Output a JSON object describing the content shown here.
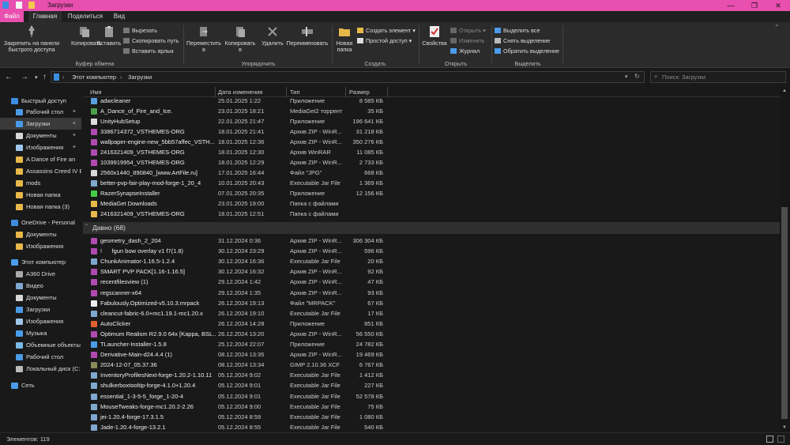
{
  "window": {
    "title": "Загрузки",
    "min": "—",
    "max": "❐",
    "close": "✕"
  },
  "tabs": [
    "Файл",
    "Главная",
    "Поделиться",
    "Вид"
  ],
  "ribbon": {
    "pin": "Закрепить на панели быстрого доступа",
    "copy": "Копировать",
    "paste": "Вставить",
    "cut": "Вырезать",
    "copy_path": "Скопировать путь",
    "paste_shortcut": "Вставить ярлык",
    "group_clipboard": "Буфер обмена",
    "move_to": "Переместить в",
    "copy_to": "Копировать в",
    "delete": "Удалить",
    "rename": "Переименовать",
    "group_organize": "Упорядочить",
    "new_folder": "Новая папка",
    "new_item": "Создать элемент",
    "easy_access": "Простой доступ",
    "group_create": "Создать",
    "properties": "Свойства",
    "open": "Открыть",
    "edit": "Изменить",
    "history": "Журнал",
    "group_open": "Открыть",
    "select_all": "Выделить все",
    "select_none": "Снять выделение",
    "invert": "Обратить выделение",
    "group_select": "Выделить"
  },
  "address": {
    "pc": "Этот компьютер",
    "folder": "Загрузки",
    "search_placeholder": "Поиск: Загрузки",
    "sep": "›"
  },
  "sidebar": [
    {
      "label": "Быстрый доступ",
      "icon": "star-icon",
      "color": "#3c8de0",
      "indent": 0
    },
    {
      "label": "Рабочий стол",
      "icon": "folder-icon",
      "color": "#4a9be8",
      "indent": 1
    },
    {
      "label": "Загрузки",
      "icon": "download-icon",
      "color": "#4a9be8",
      "indent": 1
    },
    {
      "label": "Документы",
      "icon": "document-icon",
      "color": "#d8d8d8",
      "indent": 1
    },
    {
      "label": "Изображения",
      "icon": "image-icon",
      "color": "#9fc7ec",
      "indent": 1
    },
    {
      "label": "A Dance of Fire an",
      "icon": "folder-icon",
      "color": "#e8b84a",
      "indent": 1
    },
    {
      "label": "Assassins Creed IV Bl",
      "icon": "folder-icon",
      "color": "#e8b84a",
      "indent": 1
    },
    {
      "label": "mods",
      "icon": "folder-icon",
      "color": "#e8b84a",
      "indent": 1
    },
    {
      "label": "Новая папка",
      "icon": "folder-icon",
      "color": "#e8b84a",
      "indent": 1
    },
    {
      "label": "Новая папка (3)",
      "icon": "folder-icon",
      "color": "#e8b84a",
      "indent": 1
    },
    {
      "label": "OneDrive - Personal",
      "icon": "cloud-icon",
      "color": "#3c8de0",
      "indent": 0
    },
    {
      "label": "Документы",
      "icon": "folder-icon",
      "color": "#e8b84a",
      "indent": 1
    },
    {
      "label": "Изображения",
      "icon": "folder-icon",
      "color": "#e8b84a",
      "indent": 1
    },
    {
      "label": "Этот компьютер",
      "icon": "computer-icon",
      "color": "#4a9be8",
      "indent": 0
    },
    {
      "label": "A360 Drive",
      "icon": "drive-icon",
      "color": "#aaaaaa",
      "indent": 1
    },
    {
      "label": "Видео",
      "icon": "video-icon",
      "color": "#7fa8d0",
      "indent": 1
    },
    {
      "label": "Документы",
      "icon": "document-icon",
      "color": "#d8d8d8",
      "indent": 1
    },
    {
      "label": "Загрузки",
      "icon": "download-icon",
      "color": "#4a9be8",
      "indent": 1
    },
    {
      "label": "Изображения",
      "icon": "image-icon",
      "color": "#9fc7ec",
      "indent": 1
    },
    {
      "label": "Музыка",
      "icon": "music-icon",
      "color": "#4a9be8",
      "indent": 1
    },
    {
      "label": "Объемные объекты",
      "icon": "cube-icon",
      "color": "#7ab8e8",
      "indent": 1
    },
    {
      "label": "Рабочий стол",
      "icon": "folder-icon",
      "color": "#4a9be8",
      "indent": 1
    },
    {
      "label": "Локальный диск (C:",
      "icon": "disk-icon",
      "color": "#bbbbbb",
      "indent": 1
    },
    {
      "label": "Сеть",
      "icon": "network-icon",
      "color": "#4a9be8",
      "indent": 0
    }
  ],
  "columns": {
    "name": "Имя",
    "date": "Дата изменения",
    "type": "Тип",
    "size": "Размер"
  },
  "files_top": [
    {
      "name": "adwcleaner",
      "date": "25.01.2025 1:22",
      "type": "Приложение",
      "size": "8 585 КБ",
      "color": "#5aa0e0"
    },
    {
      "name": "A_Dance_of_Fire_and_Ice.",
      "date": "23.01.2025 18:21",
      "type": "MediaGet2 торрент",
      "size": "35 КБ",
      "color": "#4aa04a"
    },
    {
      "name": "UnityHubSetup",
      "date": "22.01.2025 21:47",
      "type": "Приложение",
      "size": "196 641 КБ",
      "color": "#dddddd"
    },
    {
      "name": "3386714372_VSTHEMES-ORG",
      "date": "18.01.2025 21:41",
      "type": "Архив ZIP - WinR...",
      "size": "31 218 КБ",
      "color": "#b04ab0"
    },
    {
      "name": "wallpaper-engine-new_5bb57affec_VSTH...",
      "date": "18.01.2025 12:36",
      "type": "Архив ZIP - WinR...",
      "size": "350 276 КБ",
      "color": "#b04ab0"
    },
    {
      "name": "2416321409_VSTHEMES-ORG",
      "date": "18.01.2025 12:30",
      "type": "Архив WinRAR",
      "size": "11 085 КБ",
      "color": "#b04ab0"
    },
    {
      "name": "1039919954_VSTHEMES-ORG",
      "date": "18.01.2025 12:29",
      "type": "Архив ZIP - WinR...",
      "size": "2 733 КБ",
      "color": "#b04ab0"
    },
    {
      "name": "2560x1440_890840_[www.ArtFile.ru]",
      "date": "17.01.2025 16:44",
      "type": "Файл \"JPG\"",
      "size": "668 КБ",
      "color": "#d8d8d8"
    },
    {
      "name": "better-pvp-fair-play-mod-forge-1_20_4",
      "date": "10.01.2025 20:43",
      "type": "Executable Jar File",
      "size": "1 369 КБ",
      "color": "#7fa8d0"
    },
    {
      "name": "RazerSynapseInstaller",
      "date": "07.01.2025 20:35",
      "type": "Приложение",
      "size": "12 156 КБ",
      "color": "#44cc44"
    },
    {
      "name": "MediaGet Downloads",
      "date": "23.01.2025 19:00",
      "type": "Папка с файлами",
      "size": "",
      "color": "#e8b84a"
    },
    {
      "name": "2416321409_VSTHEMES-ORG",
      "date": "18.01.2025 12:51",
      "type": "Папка с файлами",
      "size": "",
      "color": "#e8b84a"
    }
  ],
  "group": {
    "label": "Давно (68)"
  },
  "files_old": [
    {
      "name": "geometry_dash_2_204",
      "date": "31.12.2024 0:36",
      "type": "Архив ZIP - WinR...",
      "size": "306 304 КБ",
      "color": "#b04ab0"
    },
    {
      "name": "!      fgun bow overlay v1 f7(1.8)",
      "date": "30.12.2024 23:29",
      "type": "Архив ZIP - WinR...",
      "size": "596 КБ",
      "color": "#b04ab0"
    },
    {
      "name": "ChunkAnimator-1.16.5-1.2.4",
      "date": "30.12.2024 16:36",
      "type": "Executable Jar File",
      "size": "20 КБ",
      "color": "#7fa8d0"
    },
    {
      "name": "SMART PVP PACK[1.16-1.16.5]",
      "date": "30.12.2024 16:32",
      "type": "Архив ZIP - WinR...",
      "size": "92 КБ",
      "color": "#b04ab0"
    },
    {
      "name": "recentfilesview (1)",
      "date": "29.12.2024 1:42",
      "type": "Архив ZIP - WinR...",
      "size": "47 КБ",
      "color": "#b04ab0"
    },
    {
      "name": "regscanner-x64",
      "date": "29.12.2024 1:35",
      "type": "Архив ZIP - WinR...",
      "size": "93 КБ",
      "color": "#b04ab0"
    },
    {
      "name": "Fabulously.Optimized-v5.10.3.mrpack",
      "date": "26.12.2024 19:13",
      "type": "Файл \"MRPACK\"",
      "size": "67 КБ",
      "color": "#eeeeee"
    },
    {
      "name": "cleancut-fabric-6.0+mc1.19.1-mc1.20.x",
      "date": "26.12.2024 19:10",
      "type": "Executable Jar File",
      "size": "17 КБ",
      "color": "#7fa8d0"
    },
    {
      "name": "AutoClicker",
      "date": "26.12.2024 14:28",
      "type": "Приложение",
      "size": "851 КБ",
      "color": "#e06030"
    },
    {
      "name": "Optimum Realism R2.9.0 64x [Kappa, BSL...",
      "date": "26.12.2024 13:20",
      "type": "Архив ZIP - WinR...",
      "size": "56 550 КБ",
      "color": "#b04ab0"
    },
    {
      "name": "TLauncher-Installer-1.5.8",
      "date": "25.12.2024 22:07",
      "type": "Приложение",
      "size": "24 782 КБ",
      "color": "#4a9be8"
    },
    {
      "name": "Derivative-Main-d24.4.4 (1)",
      "date": "08.12.2024 13:35",
      "type": "Архив ZIP - WinR...",
      "size": "19 469 КБ",
      "color": "#b04ab0"
    },
    {
      "name": "2024-12-07_05.37.36",
      "date": "08.12.2024 13:34",
      "type": "GIMP 2.10.36 XCF",
      "size": "6 767 КБ",
      "color": "#8a8a5a"
    },
    {
      "name": "InventoryProfilesNext-forge-1.20.2-1.10.11",
      "date": "05.12.2024 9:02",
      "type": "Executable Jar File",
      "size": "1 412 КБ",
      "color": "#7fa8d0"
    },
    {
      "name": "shulkerboxtooltip-forge-4.1.0+1.20.4",
      "date": "05.12.2024 9:01",
      "type": "Executable Jar File",
      "size": "227 КБ",
      "color": "#7fa8d0"
    },
    {
      "name": "essential_1-3-5-5_forge_1-20-4",
      "date": "05.12.2024 9:01",
      "type": "Executable Jar File",
      "size": "52 578 КБ",
      "color": "#7fa8d0"
    },
    {
      "name": "MouseTweaks-forge-mc1.20.2-2.26",
      "date": "05.12.2024 9:00",
      "type": "Executable Jar File",
      "size": "75 КБ",
      "color": "#7fa8d0"
    },
    {
      "name": "jei-1.20.4-forge-17.3.1.5",
      "date": "05.12.2024 8:59",
      "type": "Executable Jar File",
      "size": "1 080 КБ",
      "color": "#7fa8d0"
    },
    {
      "name": "Jade-1.20.4-forge-13.2.1",
      "date": "05.12.2024 8:55",
      "type": "Executable Jar File",
      "size": "540 КБ",
      "color": "#7fa8d0"
    }
  ],
  "status": {
    "items": "Элементов: 119"
  }
}
